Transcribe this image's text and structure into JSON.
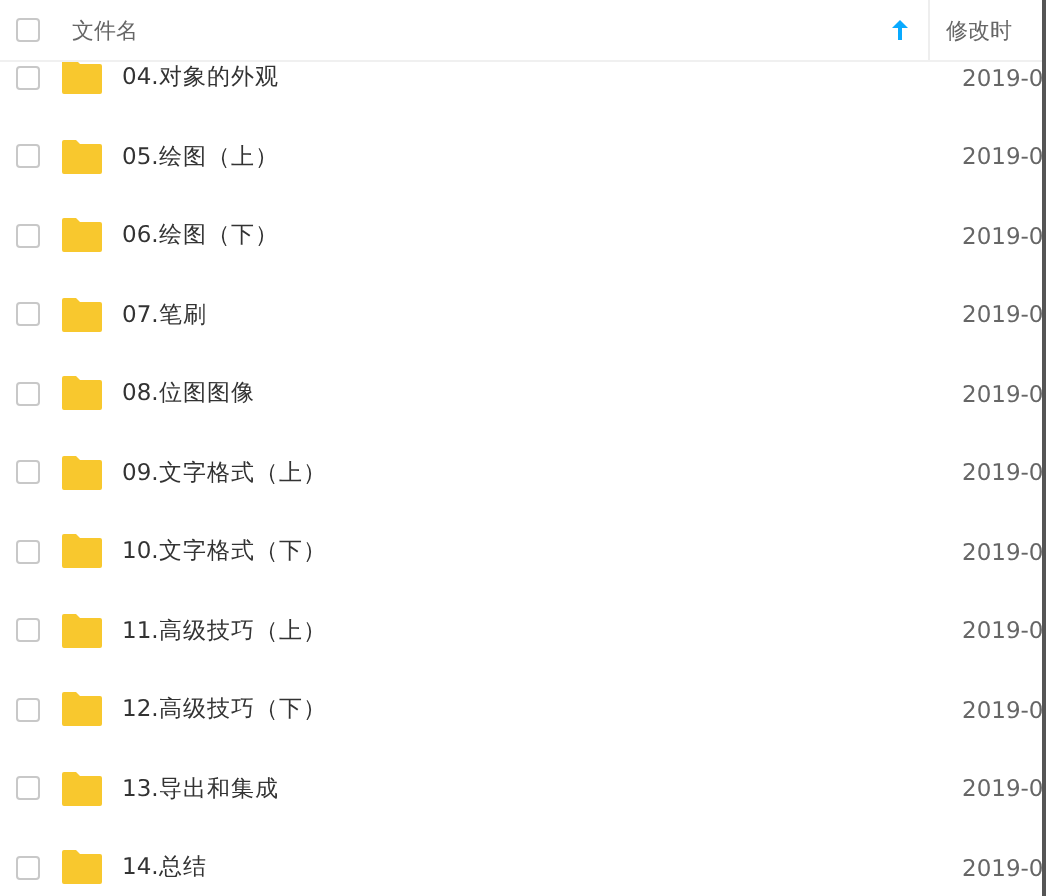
{
  "header": {
    "checked": false,
    "name_column": "文件名",
    "sort_ascending": true,
    "date_column": "修改时"
  },
  "rows": [
    {
      "name": "04.对象的外观",
      "date": "2019-0",
      "checked": false
    },
    {
      "name": "05.绘图（上）",
      "date": "2019-0",
      "checked": false
    },
    {
      "name": "06.绘图（下）",
      "date": "2019-0",
      "checked": false
    },
    {
      "name": "07.笔刷",
      "date": "2019-0",
      "checked": false
    },
    {
      "name": "08.位图图像",
      "date": "2019-0",
      "checked": false
    },
    {
      "name": "09.文字格式（上）",
      "date": "2019-0",
      "checked": false
    },
    {
      "name": "10.文字格式（下）",
      "date": "2019-0",
      "checked": false
    },
    {
      "name": "11.高级技巧（上）",
      "date": "2019-0",
      "checked": false
    },
    {
      "name": "12.高级技巧（下）",
      "date": "2019-0",
      "checked": false
    },
    {
      "name": "13.导出和集成",
      "date": "2019-0",
      "checked": false
    },
    {
      "name": "14.总结",
      "date": "2019-0",
      "checked": false
    }
  ]
}
